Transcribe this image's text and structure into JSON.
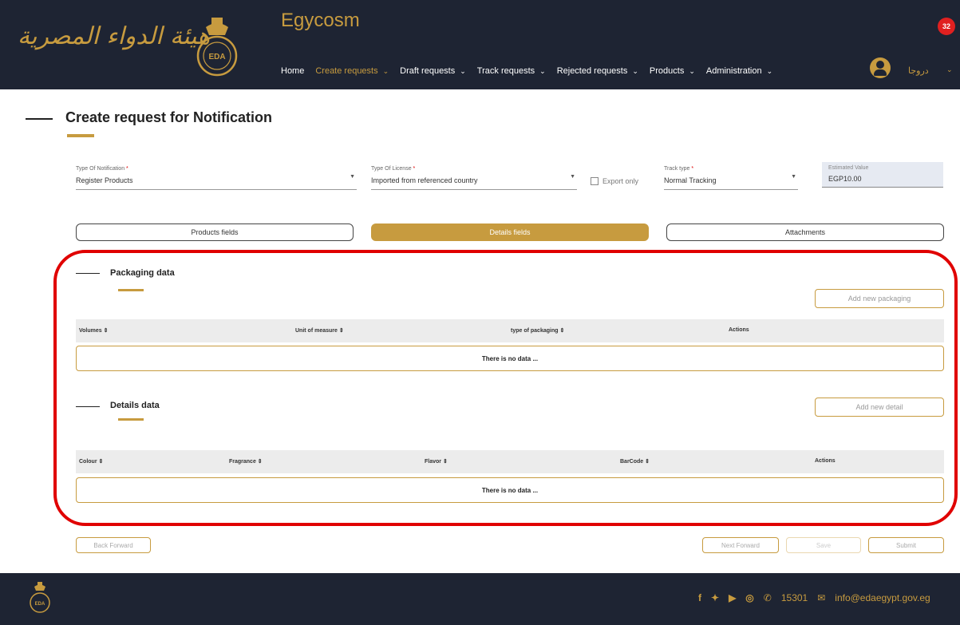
{
  "header": {
    "arabic_logo": "هيئة الدواء المصرية",
    "app_title": "Egycosm",
    "notification_count": "32",
    "nav": [
      {
        "label": "Home",
        "active": false,
        "dropdown": false
      },
      {
        "label": "Create requests",
        "active": true,
        "dropdown": true
      },
      {
        "label": "Draft requests",
        "active": false,
        "dropdown": true
      },
      {
        "label": "Track requests",
        "active": false,
        "dropdown": true
      },
      {
        "label": "Rejected requests",
        "active": false,
        "dropdown": true
      },
      {
        "label": "Products",
        "active": false,
        "dropdown": true
      },
      {
        "label": "Administration",
        "active": false,
        "dropdown": true
      }
    ],
    "user_name": "دروجا",
    "colors": {
      "bg": "#1e2433",
      "accent": "#c79b3f"
    }
  },
  "page": {
    "title": "Create request for Notification"
  },
  "form": {
    "type_of_notification": {
      "label": "Type Of Notification",
      "value": "Register Products"
    },
    "type_of_license": {
      "label": "Type Of License",
      "value": "Imported from referenced country"
    },
    "export_only": {
      "label": "Export only",
      "checked": false
    },
    "track_type": {
      "label": "Track type",
      "value": "Normal Tracking"
    },
    "estimated_value": {
      "label": "Estimated Value",
      "value": "EGP10.00"
    }
  },
  "tabs": [
    {
      "label": "Products fields",
      "active": false
    },
    {
      "label": "Details fields",
      "active": true
    },
    {
      "label": "Attachments",
      "active": false
    }
  ],
  "packaging": {
    "title": "Packaging data",
    "add_button": "Add new packaging",
    "columns": [
      "Volumes ⇕",
      "Unit of measure ⇕",
      "type of packaging ⇕",
      "Actions"
    ],
    "empty_text": "There is no data ..."
  },
  "details": {
    "title": "Details data",
    "add_button": "Add new detail",
    "columns": [
      "Colour ⇕",
      "Fragrance ⇕",
      "Flavor ⇕",
      "BarCode ⇕",
      "Actions"
    ],
    "empty_text": "There is no data ..."
  },
  "actions": {
    "back": "Back Forward",
    "next": "Next Forward",
    "save": "Save",
    "submit": "Submit"
  },
  "footer": {
    "hotline": "15301",
    "email": "info@edaegypt.gov.eg",
    "social_icons": [
      "facebook-icon",
      "twitter-icon",
      "youtube-icon",
      "instagram-icon"
    ]
  }
}
